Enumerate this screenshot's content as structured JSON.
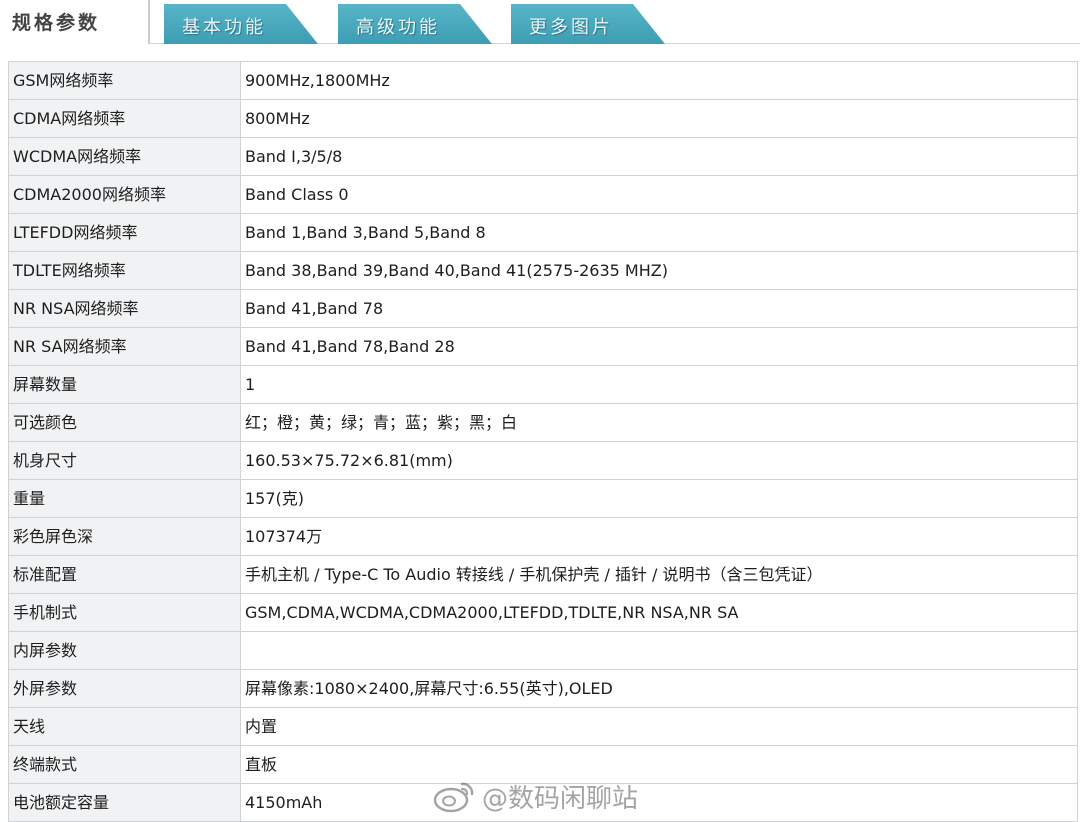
{
  "tabs": {
    "active": "规格参数",
    "items": [
      "基本功能",
      "高级功能",
      "更多图片"
    ]
  },
  "specs": [
    {
      "label": "GSM网络频率",
      "value": "900MHz,1800MHz"
    },
    {
      "label": "CDMA网络频率",
      "value": "800MHz"
    },
    {
      "label": "WCDMA网络频率",
      "value": "Band I,3/5/8"
    },
    {
      "label": "CDMA2000网络频率",
      "value": "Band Class 0"
    },
    {
      "label": "LTEFDD网络频率",
      "value": "Band 1,Band 3,Band 5,Band 8"
    },
    {
      "label": "TDLTE网络频率",
      "value": "Band 38,Band 39,Band 40,Band 41(2575-2635 MHZ)"
    },
    {
      "label": "NR NSA网络频率",
      "value": "Band 41,Band 78"
    },
    {
      "label": "NR SA网络频率",
      "value": "Band 41,Band 78,Band 28"
    },
    {
      "label": "屏幕数量",
      "value": "1"
    },
    {
      "label": "可选颜色",
      "value": "红；橙；黄；绿；青；蓝；紫；黑；白"
    },
    {
      "label": "机身尺寸",
      "value": "160.53×75.72×6.81(mm)"
    },
    {
      "label": "重量",
      "value": "157(克)"
    },
    {
      "label": "彩色屏色深",
      "value": "107374万"
    },
    {
      "label": "标准配置",
      "value": "手机主机 / Type-C To Audio 转接线 / 手机保护壳 / 插针 / 说明书（含三包凭证）"
    },
    {
      "label": "手机制式",
      "value": "GSM,CDMA,WCDMA,CDMA2000,LTEFDD,TDLTE,NR NSA,NR SA"
    },
    {
      "label": "内屏参数",
      "value": ""
    },
    {
      "label": "外屏参数",
      "value": "屏幕像素:1080×2400,屏幕尺寸:6.55(英寸),OLED"
    },
    {
      "label": "天线",
      "value": "内置"
    },
    {
      "label": "终端款式",
      "value": "直板"
    },
    {
      "label": "电池额定容量",
      "value": "4150mAh"
    }
  ],
  "watermark": {
    "text": "@数码闲聊站",
    "icon": "weibo-icon"
  },
  "colors": {
    "tab_bg": "#4aa9be",
    "label_bg": "#f1f2f3",
    "border": "#cfd3d6"
  }
}
